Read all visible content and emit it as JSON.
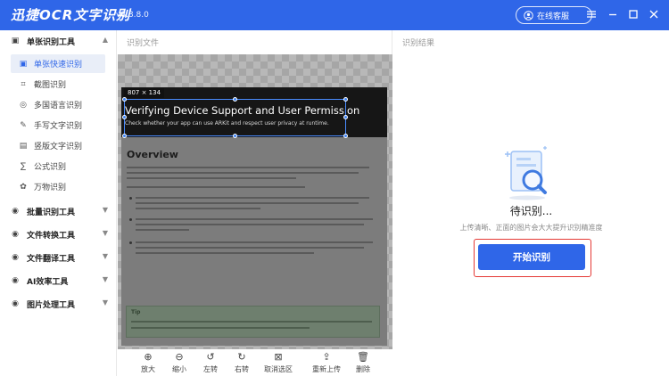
{
  "app": {
    "title": "迅捷OCR文字识别",
    "version": "v8.8.8.0",
    "customer_service": "在线客服"
  },
  "sidebar": {
    "groups": [
      {
        "label": "单张识别工具",
        "icon": "image-icon",
        "expanded": true,
        "items": [
          {
            "label": "单张快速识别",
            "icon": "image-icon",
            "active": true
          },
          {
            "label": "截图识别",
            "icon": "crop-icon"
          },
          {
            "label": "多国语言识别",
            "icon": "globe-icon"
          },
          {
            "label": "手写文字识别",
            "icon": "pen-icon"
          },
          {
            "label": "竖版文字识别",
            "icon": "vertical-text-icon"
          },
          {
            "label": "公式识别",
            "icon": "formula-icon"
          },
          {
            "label": "万物识别",
            "icon": "flower-icon"
          }
        ]
      },
      {
        "label": "批量识别工具",
        "icon": "batch-icon",
        "expanded": false
      },
      {
        "label": "文件转换工具",
        "icon": "convert-icon",
        "expanded": false
      },
      {
        "label": "文件翻译工具",
        "icon": "translate-icon",
        "expanded": false
      },
      {
        "label": "AI效率工具",
        "icon": "ai-icon",
        "expanded": false
      },
      {
        "label": "图片处理工具",
        "icon": "image-process-icon",
        "expanded": false
      }
    ]
  },
  "file_panel": {
    "label": "识别文件",
    "document": {
      "size_badge": "807 × 134",
      "title": "Verifying Device Support and User Permission",
      "subtitle": "Check whether your app can use ARKit and respect user privacy at runtime.",
      "section": "Overview",
      "tip_label": "Tip"
    },
    "tools": [
      {
        "label": "放大",
        "icon": "zoom-in-icon"
      },
      {
        "label": "缩小",
        "icon": "zoom-out-icon"
      },
      {
        "label": "左转",
        "icon": "rotate-left-icon"
      },
      {
        "label": "右转",
        "icon": "rotate-right-icon"
      },
      {
        "label": "取消选区",
        "icon": "cancel-selection-icon"
      },
      {
        "label": "重新上传",
        "icon": "upload-icon"
      },
      {
        "label": "删除",
        "icon": "trash-icon"
      }
    ]
  },
  "result_panel": {
    "label": "识别结果",
    "status": "待识别...",
    "hint": "上传清晰、正面的图片会大大提升识别精准度",
    "start_button": "开始识别"
  },
  "colors": {
    "accent": "#2f66e8",
    "highlight_border": "#e53935",
    "active_bg": "#e9eef8"
  }
}
